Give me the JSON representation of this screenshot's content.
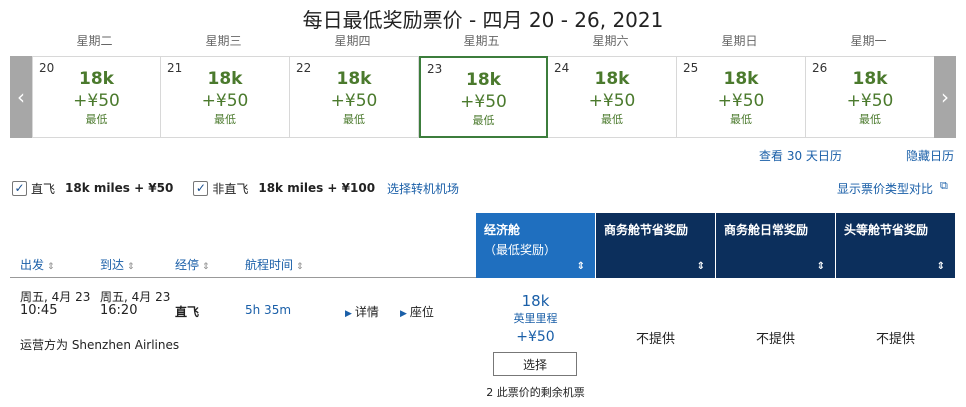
{
  "title": "每日最低奖励票价 - 四月 20 - 26, 2021",
  "weekdays": [
    "星期二",
    "星期三",
    "星期四",
    "星期五",
    "星期六",
    "星期日",
    "星期一"
  ],
  "calendar": {
    "prev_icon": "chevron-left-icon",
    "next_icon": "chevron-right-icon",
    "selected_index": 3,
    "days": [
      {
        "day": "20",
        "miles": "18k",
        "fee": "+¥50",
        "note": "最低"
      },
      {
        "day": "21",
        "miles": "18k",
        "fee": "+¥50",
        "note": "最低"
      },
      {
        "day": "22",
        "miles": "18k",
        "fee": "+¥50",
        "note": "最低"
      },
      {
        "day": "23",
        "miles": "18k",
        "fee": "+¥50",
        "note": "最低"
      },
      {
        "day": "24",
        "miles": "18k",
        "fee": "+¥50",
        "note": "最低"
      },
      {
        "day": "25",
        "miles": "18k",
        "fee": "+¥50",
        "note": "最低"
      },
      {
        "day": "26",
        "miles": "18k",
        "fee": "+¥50",
        "note": "最低"
      }
    ]
  },
  "links": {
    "view_30": "查看 30 天日历",
    "hide_calendar": "隐藏日历",
    "select_airport": "选择转机机场",
    "compare_fare_types": "显示票价类型对比"
  },
  "filters": {
    "nonstop": {
      "label": "直飞",
      "price": "18k miles + ¥50",
      "checked": true
    },
    "connecting": {
      "label": "非直飞",
      "price": "18k miles + ¥100",
      "checked": true
    }
  },
  "columns": {
    "depart": "出发",
    "arrive": "到达",
    "stops": "经停",
    "duration": "航程时间"
  },
  "fare_types": [
    {
      "line1": "经济舱",
      "line2": "（最低奖励）"
    },
    {
      "line1": "商务舱节省奖励",
      "line2": ""
    },
    {
      "line1": "商务舱日常奖励",
      "line2": ""
    },
    {
      "line1": "头等舱节省奖励",
      "line2": ""
    }
  ],
  "flight": {
    "depart_date": "周五, 4月 23",
    "depart_time": "10:45",
    "arrive_date": "周五, 4月 23",
    "arrive_time": "16:20",
    "stops": "直飞",
    "duration": "5h 35m",
    "details": "详情",
    "seats": "座位",
    "operated_by": "运营方为 Shenzhen Airlines",
    "econ_miles": "18k",
    "econ_unit": "英里里程",
    "econ_price": "+¥50",
    "select": "选择",
    "seats_left": "2 此票价的剩余机票",
    "not_available": "不提供"
  }
}
